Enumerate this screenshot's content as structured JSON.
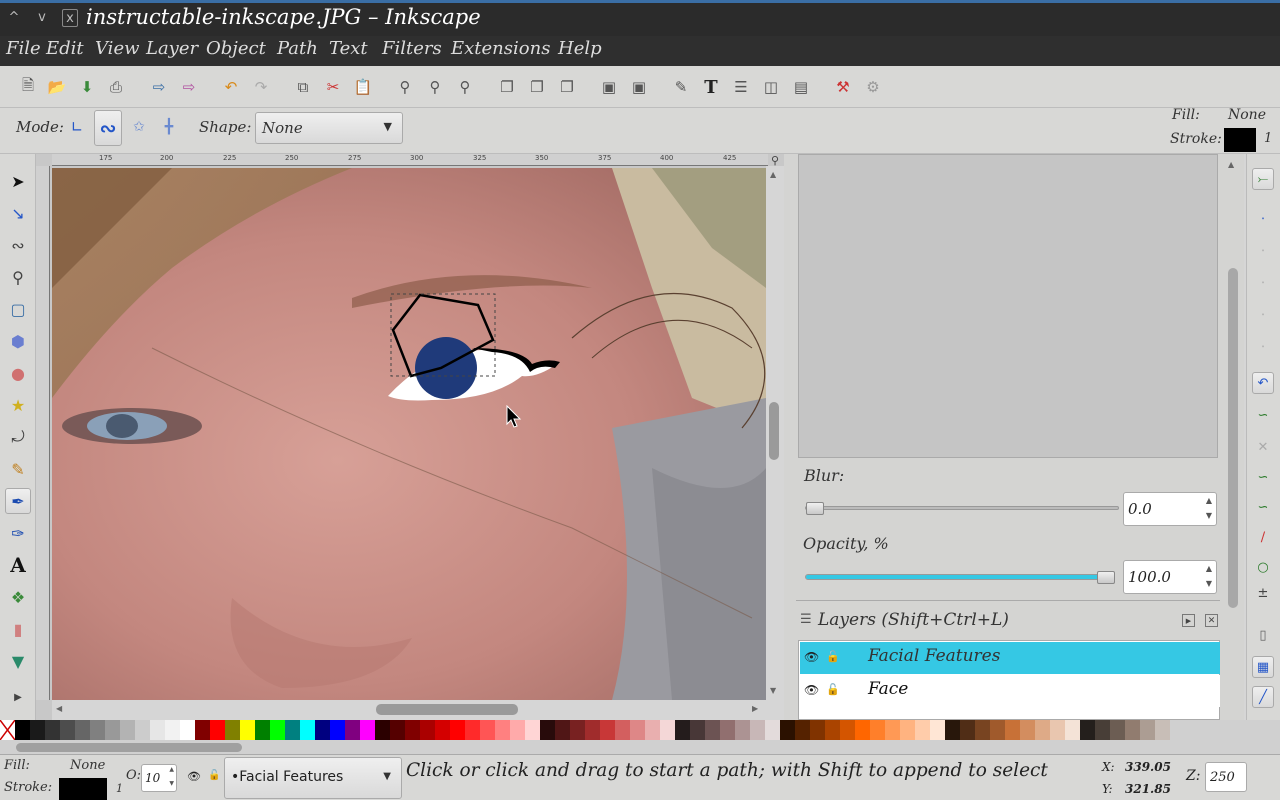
{
  "window": {
    "title": "instructable-inkscape.JPG – Inkscape",
    "controls": [
      "^",
      "v",
      "x"
    ]
  },
  "menu": [
    "File",
    "Edit",
    "View",
    "Layer",
    "Object",
    "Path",
    "Text",
    "Filters",
    "Extensions",
    "Help"
  ],
  "ctrl": {
    "mode_label": "Mode:",
    "shape_label": "Shape:",
    "shape_value": "None",
    "fill_label": "Fill:",
    "fill_value": "None",
    "stroke_label": "Stroke:",
    "stroke_width": "1"
  },
  "rulers": {
    "top": [
      "175",
      "200",
      "225",
      "250",
      "275",
      "300",
      "325",
      "350",
      "375",
      "400",
      "425"
    ]
  },
  "panel": {
    "blur_label": "Blur:",
    "blur_value": "0.0",
    "blur_level": 0.0,
    "opacity_label": "Opacity, %",
    "opacity_value": "100.0",
    "opacity_level": 1.0,
    "layers_title": "Layers (Shift+Ctrl+L)",
    "layers": [
      {
        "name": "Facial Features",
        "selected": true,
        "visible": true,
        "locked": false
      },
      {
        "name": "Face",
        "selected": false,
        "visible": true,
        "locked": false
      }
    ]
  },
  "palette": [
    "none",
    "#000000",
    "#1a1a1a",
    "#333333",
    "#4d4d4d",
    "#666666",
    "#808080",
    "#999999",
    "#b3b3b3",
    "#cccccc",
    "#e6e6e6",
    "#f2f2f2",
    "#ffffff",
    "#800000",
    "#ff0000",
    "#808000",
    "#ffff00",
    "#008000",
    "#00ff00",
    "#008080",
    "#00ffff",
    "#000080",
    "#0000ff",
    "#800080",
    "#ff00ff",
    "#2b0000",
    "#550000",
    "#800000",
    "#aa0000",
    "#d40000",
    "#ff0000",
    "#ff2a2a",
    "#ff5555",
    "#ff8080",
    "#ffaaaa",
    "#ffd5d5",
    "#280b0b",
    "#501616",
    "#782121",
    "#a02c2c",
    "#c83737",
    "#d35f5f",
    "#de8787",
    "#e9afaf",
    "#f4d7d7",
    "#241c1c",
    "#483737",
    "#6c5353",
    "#916f6f",
    "#ac9393",
    "#c8b7b7",
    "#e3dbdb",
    "#2b1100",
    "#552200",
    "#803300",
    "#aa4400",
    "#d45500",
    "#ff6600",
    "#ff7f2a",
    "#ff9955",
    "#ffb380",
    "#ffccaa",
    "#ffe6d5",
    "#28170b",
    "#502d16",
    "#784421",
    "#a05a2c",
    "#c87137",
    "#d38d5f",
    "#deaa87",
    "#e9c6af",
    "#f4e3d7",
    "#241f1c",
    "#483e37",
    "#6c5d53",
    "#917c6f",
    "#ac9d93",
    "#c8beb7"
  ],
  "status": {
    "fill_label": "Fill:",
    "fill_value": "None",
    "stroke_label": "Stroke:",
    "stroke_width": "1",
    "opacity_label": "O:",
    "opacity_value": "10",
    "layer_value": "•Facial Features",
    "message": "Click or click and drag to start a path; with Shift to append to select",
    "x_label": "X:",
    "x_value": "339.05",
    "y_label": "Y:",
    "y_value": "321.85",
    "zoom_label": "Z:",
    "zoom_value": "250"
  },
  "colors": {
    "accent": "#35c8e4",
    "circle_fill": "#1f3a7a",
    "titlebar": "#2b2b2b"
  }
}
